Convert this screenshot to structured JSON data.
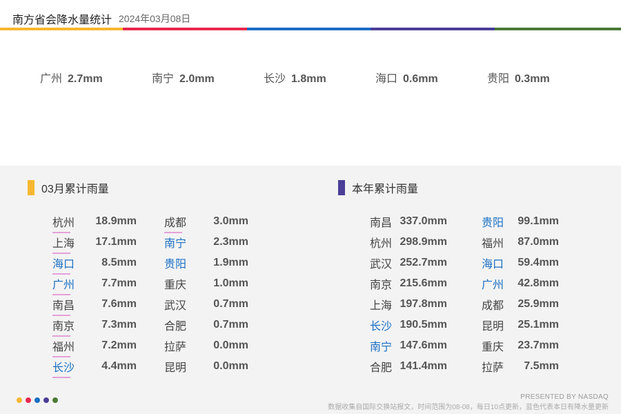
{
  "header": {
    "title": "南方省会降水量统计",
    "date": "2024年03月08日"
  },
  "colors": {
    "bar": [
      "#f7b731",
      "#e8284f",
      "#1a6fc4",
      "#4a3e98",
      "#4a7a36"
    ],
    "blue_city": "#1a6fc4",
    "underline": "#e5a0d8",
    "marker_month": "#f7b731",
    "marker_year": "#4a3e98"
  },
  "today": [
    {
      "city": "广州",
      "value": "2.7mm"
    },
    {
      "city": "南宁",
      "value": "2.0mm"
    },
    {
      "city": "长沙",
      "value": "1.8mm"
    },
    {
      "city": "海口",
      "value": "0.6mm"
    },
    {
      "city": "贵阳",
      "value": "0.3mm"
    }
  ],
  "month_panel": {
    "title": "03月累计雨量",
    "col1": [
      {
        "city": "杭州",
        "value": "18.9mm",
        "blue": false,
        "underline": true
      },
      {
        "city": "上海",
        "value": "17.1mm",
        "blue": false,
        "underline": true
      },
      {
        "city": "海口",
        "value": "8.5mm",
        "blue": true,
        "underline": true
      },
      {
        "city": "广州",
        "value": "7.7mm",
        "blue": true,
        "underline": true
      },
      {
        "city": "南昌",
        "value": "7.6mm",
        "blue": false,
        "underline": true
      },
      {
        "city": "南京",
        "value": "7.3mm",
        "blue": false,
        "underline": true
      },
      {
        "city": "福州",
        "value": "7.2mm",
        "blue": false,
        "underline": true
      },
      {
        "city": "长沙",
        "value": "4.4mm",
        "blue": true,
        "underline": true
      }
    ],
    "col2": [
      {
        "city": "成都",
        "value": "3.0mm",
        "blue": false,
        "underline": true
      },
      {
        "city": "南宁",
        "value": "2.3mm",
        "blue": true,
        "underline": false
      },
      {
        "city": "贵阳",
        "value": "1.9mm",
        "blue": true,
        "underline": false
      },
      {
        "city": "重庆",
        "value": "1.0mm",
        "blue": false,
        "underline": false
      },
      {
        "city": "武汉",
        "value": "0.7mm",
        "blue": false,
        "underline": false
      },
      {
        "city": "合肥",
        "value": "0.7mm",
        "blue": false,
        "underline": false
      },
      {
        "city": "拉萨",
        "value": "0.0mm",
        "blue": false,
        "underline": false
      },
      {
        "city": "昆明",
        "value": "0.0mm",
        "blue": false,
        "underline": false
      }
    ]
  },
  "year_panel": {
    "title": "本年累计雨量",
    "col1": [
      {
        "city": "南昌",
        "value": "337.0mm",
        "blue": false
      },
      {
        "city": "杭州",
        "value": "298.9mm",
        "blue": false
      },
      {
        "city": "武汉",
        "value": "252.7mm",
        "blue": false
      },
      {
        "city": "南京",
        "value": "215.6mm",
        "blue": false
      },
      {
        "city": "上海",
        "value": "197.8mm",
        "blue": false
      },
      {
        "city": "长沙",
        "value": "190.5mm",
        "blue": true
      },
      {
        "city": "南宁",
        "value": "147.6mm",
        "blue": true
      },
      {
        "city": "合肥",
        "value": "141.4mm",
        "blue": false
      }
    ],
    "col2": [
      {
        "city": "贵阳",
        "value": "99.1mm",
        "blue": true
      },
      {
        "city": "福州",
        "value": "87.0mm",
        "blue": false
      },
      {
        "city": "海口",
        "value": "59.4mm",
        "blue": true
      },
      {
        "city": "广州",
        "value": "42.8mm",
        "blue": true
      },
      {
        "city": "成都",
        "value": "25.9mm",
        "blue": false
      },
      {
        "city": "昆明",
        "value": "25.1mm",
        "blue": false
      },
      {
        "city": "重庆",
        "value": "23.7mm",
        "blue": false
      },
      {
        "city": "拉萨",
        "value": "7.5mm",
        "blue": false
      }
    ]
  },
  "footer": {
    "presented": "PRESENTED BY NASDAQ",
    "note": "数据收集自国际交换站报文，时间范围为08-08，每日10点更新，蓝色代表本日有降水量更新"
  }
}
